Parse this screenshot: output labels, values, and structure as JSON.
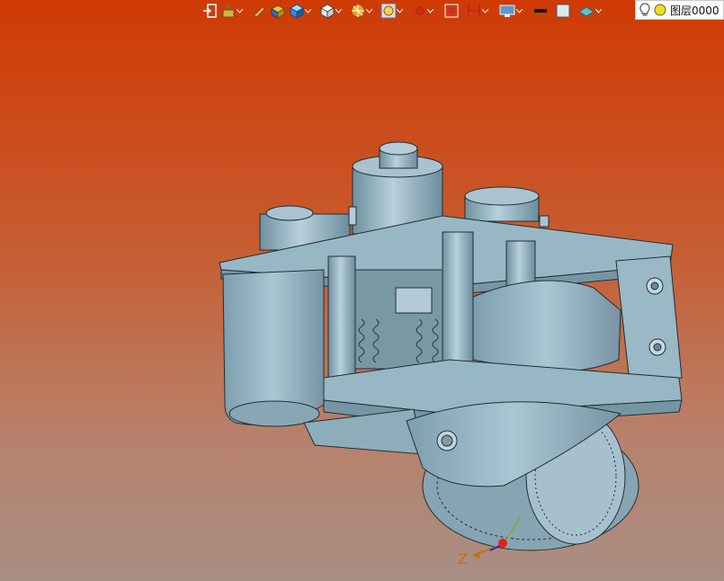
{
  "colors": {
    "background_top": "#cf3a04",
    "background_bottom": "#a98e84",
    "model_fill": "#8fb0bf",
    "model_edge": "#1f2f38",
    "axis_z": "#c07020",
    "axis_origin": "#e02020"
  },
  "toolbar": {
    "icons": [
      "exit-icon",
      "render-mode-icon",
      "pen-icon",
      "box-yellow-icon",
      "cube-blue-icon",
      "cube-white-icon",
      "section-disc-icon",
      "appearance-icon",
      "snap-icon",
      "crop-icon",
      "dimension-icon",
      "display-icon",
      "line-color-swatch",
      "fill-color-swatch",
      "surface-icon"
    ]
  },
  "layer": {
    "bulb_icon": "light-bulb-icon",
    "status_icon": "yellow-circle-icon",
    "label": "图层0000"
  },
  "triad": {
    "z_label": "Z"
  }
}
